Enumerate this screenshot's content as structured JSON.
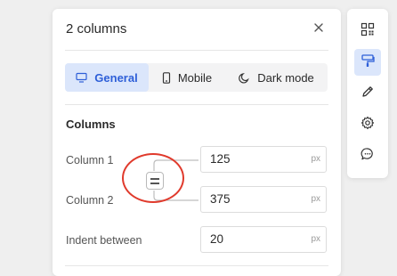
{
  "panel": {
    "title": "2 columns",
    "tabs": [
      {
        "label": "General",
        "icon": "monitor-icon",
        "active": true
      },
      {
        "label": "Mobile",
        "icon": "mobile-icon",
        "active": false
      },
      {
        "label": "Dark mode",
        "icon": "dark-mode-icon",
        "active": false
      }
    ],
    "section_title": "Columns",
    "fields": {
      "column1": {
        "label": "Column 1",
        "value": "125",
        "unit": "px"
      },
      "column2": {
        "label": "Column 2",
        "value": "375",
        "unit": "px"
      },
      "indent": {
        "label": "Indent between",
        "value": "20",
        "unit": "px"
      }
    }
  },
  "toolbar": {
    "items": [
      {
        "icon": "qr-code-icon",
        "active": false
      },
      {
        "icon": "paint-roller-icon",
        "active": true
      },
      {
        "icon": "pencil-icon",
        "active": false
      },
      {
        "icon": "gear-icon",
        "active": false
      },
      {
        "icon": "chat-bubble-icon",
        "active": false
      }
    ]
  },
  "colors": {
    "accent": "#2e5fd8",
    "accent_bg": "#dbe6fb",
    "highlight_circle": "#e03a2c"
  }
}
